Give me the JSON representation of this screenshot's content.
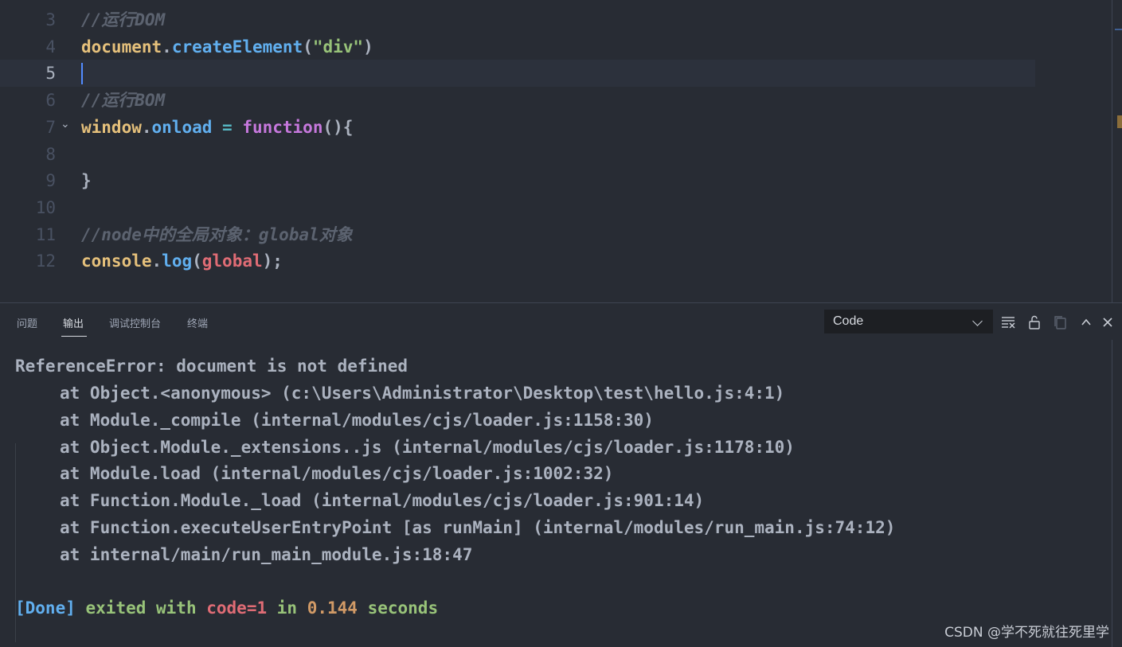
{
  "editor": {
    "active_line": "5",
    "lines": [
      {
        "num": "3",
        "tokens": [
          {
            "t": "//运行DOM",
            "c": "c-comment"
          }
        ]
      },
      {
        "num": "4",
        "tokens": [
          {
            "t": "document",
            "c": "c-var"
          },
          {
            "t": ".",
            "c": "c-punc"
          },
          {
            "t": "createElement",
            "c": "c-fn"
          },
          {
            "t": "(",
            "c": "c-punc"
          },
          {
            "t": "\"div\"",
            "c": "c-str"
          },
          {
            "t": ")",
            "c": "c-punc"
          }
        ]
      },
      {
        "num": "5",
        "tokens": []
      },
      {
        "num": "6",
        "tokens": [
          {
            "t": "//运行BOM",
            "c": "c-comment"
          }
        ]
      },
      {
        "num": "7",
        "fold": true,
        "tokens": [
          {
            "t": "window",
            "c": "c-var"
          },
          {
            "t": ".",
            "c": "c-punc"
          },
          {
            "t": "onload",
            "c": "c-fn"
          },
          {
            "t": " = ",
            "c": "c-op"
          },
          {
            "t": "function",
            "c": "c-kw"
          },
          {
            "t": "(){",
            "c": "c-punc"
          }
        ]
      },
      {
        "num": "8",
        "tokens": []
      },
      {
        "num": "9",
        "tokens": [
          {
            "t": "}",
            "c": "c-punc"
          }
        ]
      },
      {
        "num": "10",
        "tokens": []
      },
      {
        "num": "11",
        "tokens": [
          {
            "t": "//node中的全局对象：global对象",
            "c": "c-comment"
          }
        ]
      },
      {
        "num": "12",
        "tokens": [
          {
            "t": "console",
            "c": "c-var"
          },
          {
            "t": ".",
            "c": "c-punc"
          },
          {
            "t": "log",
            "c": "c-fn"
          },
          {
            "t": "(",
            "c": "c-punc"
          },
          {
            "t": "global",
            "c": "c-glob"
          },
          {
            "t": ");",
            "c": "c-punc"
          }
        ]
      }
    ]
  },
  "panel": {
    "tabs": [
      {
        "label": "问题",
        "active": false
      },
      {
        "label": "输出",
        "active": true
      },
      {
        "label": "调试控制台",
        "active": false
      },
      {
        "label": "终端",
        "active": false
      }
    ],
    "output_channel": "Code",
    "icons": [
      "clear-output-icon",
      "lock-scroll-icon",
      "copy-icon",
      "maximize-panel-icon",
      "close-panel-icon"
    ]
  },
  "output": {
    "error": "ReferenceError: document is not defined",
    "stack": [
      "at Object.<anonymous> (c:\\Users\\Administrator\\Desktop\\test\\hello.js:4:1)",
      "at Module._compile (internal/modules/cjs/loader.js:1158:30)",
      "at Object.Module._extensions..js (internal/modules/cjs/loader.js:1178:10)",
      "at Module.load (internal/modules/cjs/loader.js:1002:32)",
      "at Function.Module._load (internal/modules/cjs/loader.js:901:14)",
      "at Function.executeUserEntryPoint [as runMain] (internal/modules/run_main.js:74:12)",
      "at internal/main/run_main_module.js:18:47"
    ],
    "done": {
      "tag": "[Done]",
      "text1": "exited with",
      "code": "code=1",
      "text2": "in",
      "seconds": "0.144",
      "text3": "seconds"
    }
  },
  "watermark": "CSDN @学不死就往死里学",
  "colors": {
    "background": "#282c34",
    "comment": "#5c6370",
    "variable": "#e5c07b",
    "function": "#61afef",
    "string": "#98c379",
    "keyword": "#c678dd",
    "error_red": "#e06c75",
    "number": "#d19a66"
  }
}
